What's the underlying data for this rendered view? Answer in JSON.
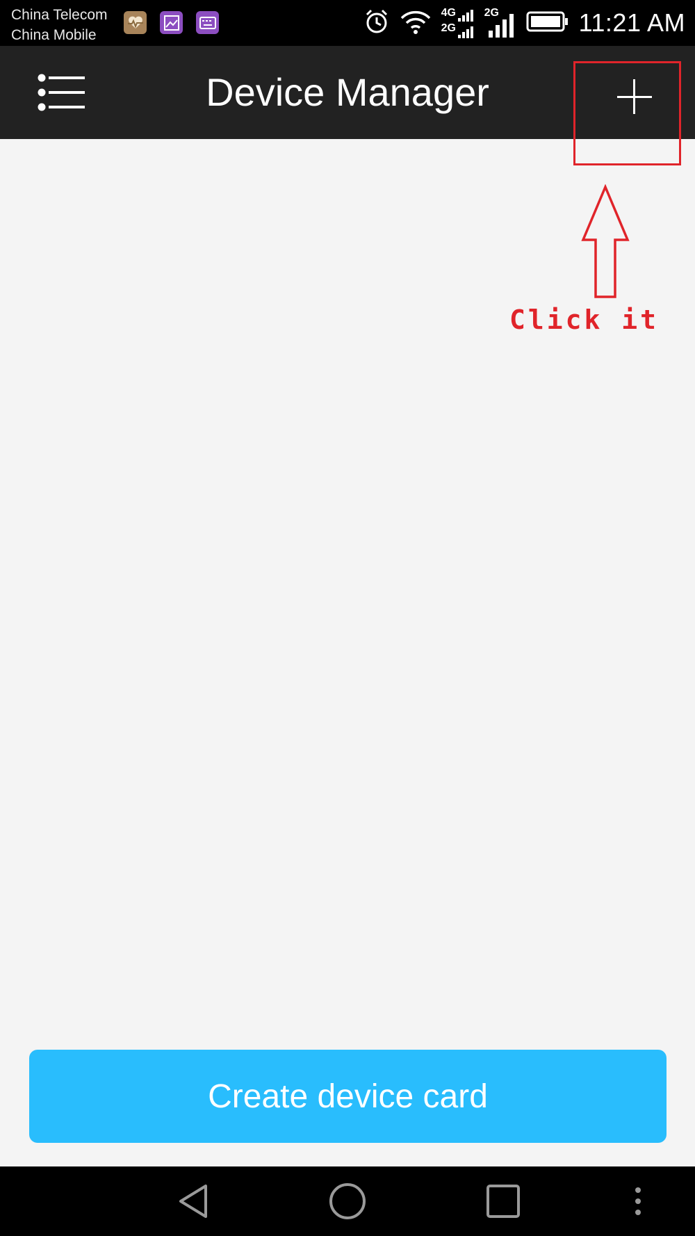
{
  "status_bar": {
    "carrier_1": "China Telecom",
    "carrier_2": "China Mobile",
    "network_1": "4G",
    "network_2": "2G",
    "network_3": "2G",
    "time": "11:21 AM"
  },
  "app_bar": {
    "title": "Device Manager"
  },
  "annotation": {
    "text": "Click it",
    "color": "#e0242a"
  },
  "main": {
    "create_button_label": "Create device card"
  },
  "colors": {
    "app_bar_bg": "#222222",
    "page_bg": "#f4f4f4",
    "button_bg": "#29bdfd"
  }
}
